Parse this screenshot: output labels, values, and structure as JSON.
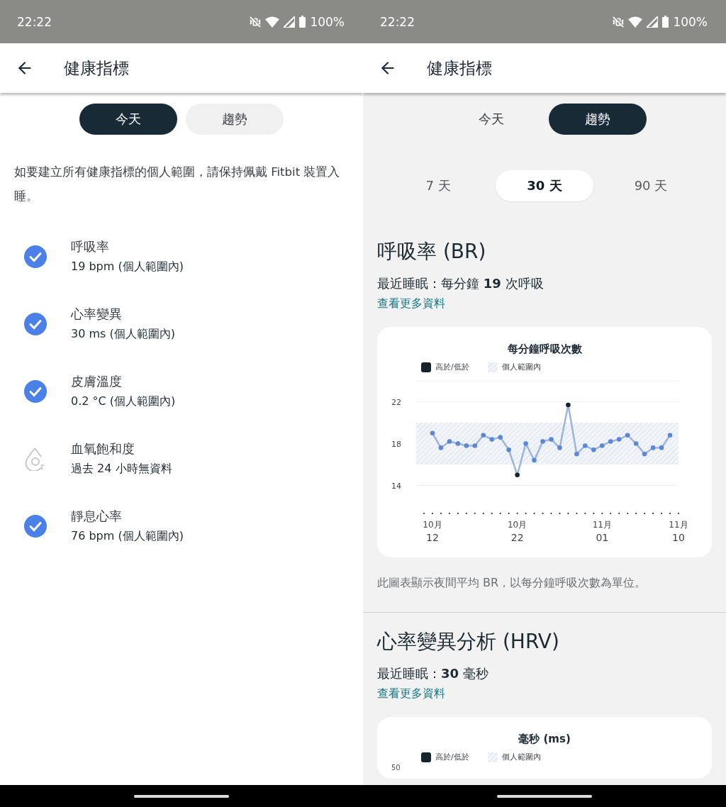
{
  "today_screen": {
    "status_bar": {
      "time": "22:22",
      "battery": "100%"
    },
    "app_bar": {
      "title": "健康指標"
    },
    "view_toggle": [
      {
        "label": "今天",
        "selected": true
      },
      {
        "label": "趨勢",
        "selected": false
      }
    ],
    "notice": "如要建立所有健康指標的個人範圍，請保持佩戴 Fitbit 裝置入睡。",
    "metrics": [
      {
        "name": "呼吸率",
        "value": "19 bpm (個人範圍內)",
        "checked": true
      },
      {
        "name": "心率變異",
        "value": "30 ms (個人範圍內)",
        "checked": true
      },
      {
        "name": "皮膚溫度",
        "value": "0.2 °C (個人範圍內)",
        "checked": true
      },
      {
        "name": "血氧飽和度",
        "value": "過去 24 小時無資料",
        "checked": false
      },
      {
        "name": "靜息心率",
        "value": "76 bpm (個人範圍內)",
        "checked": true
      }
    ]
  },
  "trends_screen": {
    "status_bar": {
      "time": "22:22",
      "battery": "100%"
    },
    "app_bar": {
      "title": "健康指標"
    },
    "view_toggle": [
      {
        "label": "今天",
        "selected": false
      },
      {
        "label": "趨勢",
        "selected": true
      }
    ],
    "range_tabs": [
      {
        "label": "7 天",
        "selected": false
      },
      {
        "label": "30 天",
        "selected": true
      },
      {
        "label": "90 天",
        "selected": false
      }
    ],
    "sections": [
      {
        "title": "呼吸率 (BR)",
        "summary": "最近睡眠：每分鐘 **19** 次呼吸",
        "link": "查看更多資料",
        "legend": [
          "高於/低於",
          "個人範圍內"
        ],
        "chart_data": {
          "type": "line",
          "title": "每分鐘呼吸次數",
          "categories": [
            null,
            "10月\n12",
            null,
            null,
            null,
            null,
            null,
            null,
            null,
            null,
            null,
            "10月\n22",
            null,
            null,
            null,
            null,
            null,
            null,
            null,
            null,
            null,
            "11月\n01",
            null,
            null,
            null,
            null,
            null,
            null,
            null,
            null,
            "11月\n10"
          ],
          "series": [
            {
              "color": "#5b87d4",
              "marker": "o",
              "values": [
                null,
                19.0,
                17.6,
                18.2,
                18.0,
                17.8,
                17.8,
                18.8,
                18.4,
                18.6,
                17.4,
                15.0,
                18.0,
                16.4,
                18.2,
                18.4,
                17.6,
                21.7,
                17.0,
                17.8,
                17.4,
                17.8,
                18.2,
                18.4,
                18.8,
                18.0,
                17.0,
                17.6,
                17.6,
                18.8,
                null
              ]
            }
          ],
          "ylim": [
            14,
            24
          ],
          "yticks": [
            14,
            18,
            22
          ],
          "bands": [
            {
              "axis": "y",
              "from": 16,
              "to": 20
            }
          ]
        },
        "caption": "此圖表顯示夜間平均 BR，以每分鐘呼吸次數為單位。"
      },
      {
        "title": "心率變異分析 (HRV)",
        "summary": "最近睡眠：**30** 毫秒",
        "link": "查看更多資料",
        "chart_title": "毫秒 (ms)",
        "legend": [
          "高於/低於",
          "個人範圍內"
        ],
        "first_ytick": "50"
      }
    ]
  }
}
